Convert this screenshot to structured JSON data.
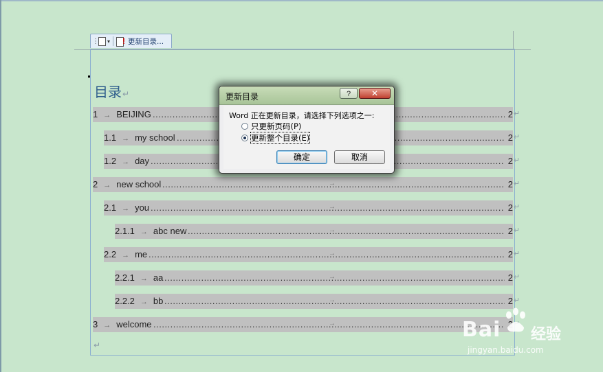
{
  "content_control": {
    "grip_icon": "grip-icon",
    "doc_icon": "document-icon",
    "update_icon": "update-toc-icon",
    "update_label": "更新目录..."
  },
  "document": {
    "heading": "目录",
    "pilcrow": "↵",
    "tab_arrow": "→",
    "toc": [
      {
        "num": "1",
        "title": "BEIJING",
        "page": "2"
      },
      {
        "num": "1.1",
        "title": "my school",
        "page": "2"
      },
      {
        "num": "1.2",
        "title": "day",
        "page": "2"
      },
      {
        "num": "2",
        "title": "new school",
        "page": "2"
      },
      {
        "num": "2.1",
        "title": "you",
        "page": "2"
      },
      {
        "num": "2.1.1",
        "title": "abc new",
        "page": "2"
      },
      {
        "num": "2.2",
        "title": "me",
        "page": "2"
      },
      {
        "num": "2.2.1",
        "title": "aa",
        "page": "2"
      },
      {
        "num": "2.2.2",
        "title": "bb",
        "page": "2"
      },
      {
        "num": "3",
        "title": "welcome",
        "page": "2"
      }
    ]
  },
  "dialog": {
    "title": "更新目录",
    "help_label": "?",
    "close_label": "✕",
    "prompt": "Word 正在更新目录，请选择下列选项之一:",
    "options": [
      {
        "label": "只更新页码(P)",
        "checked": false
      },
      {
        "label": "更新整个目录(E)",
        "checked": true
      }
    ],
    "ok_label": "确定",
    "cancel_label": "取消"
  },
  "watermark": {
    "brand": "Bai",
    "brand_cn": "经验",
    "url": "jingyan.baidu.com"
  }
}
